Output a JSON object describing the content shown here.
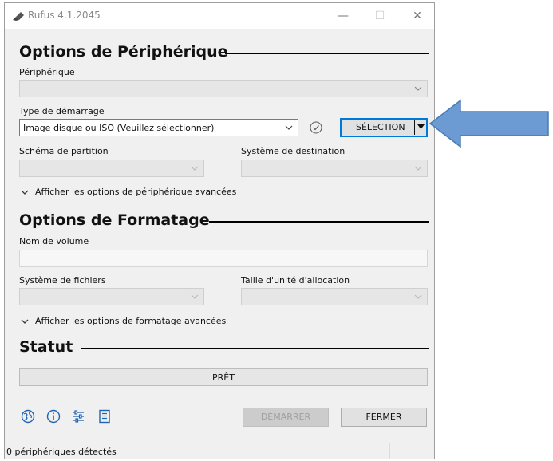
{
  "window": {
    "title": "Rufus 4.1.2045",
    "minimize": "—",
    "maximize": "☐",
    "close": "✕"
  },
  "device_section": {
    "heading": "Options de Périphérique",
    "device_label": "Périphérique",
    "device_value": "",
    "boot_type_label": "Type de démarrage",
    "boot_type_value": "Image disque ou ISO (Veuillez sélectionner)",
    "select_button": "SÉLECTION",
    "partition_label": "Schéma de partition",
    "partition_value": "",
    "target_label": "Système de destination",
    "target_value": "",
    "advanced_toggle": "Afficher les options de périphérique avancées"
  },
  "format_section": {
    "heading": "Options de Formatage",
    "volume_label": "Nom de volume",
    "volume_value": "",
    "filesystem_label": "Système de fichiers",
    "filesystem_value": "",
    "cluster_label": "Taille d'unité d'allocation",
    "cluster_value": "",
    "advanced_toggle": "Afficher les options de formatage avancées"
  },
  "status_section": {
    "heading": "Statut",
    "progress_text": "PRÊT",
    "progress_fraction": 0
  },
  "toolbar": {
    "icons": [
      "globe-icon",
      "info-icon",
      "settings-sliders-icon",
      "log-icon"
    ]
  },
  "buttons": {
    "start": "DÉMARRER",
    "close": "FERMER"
  },
  "statusbar": {
    "text": "0 périphériques détectés"
  },
  "colors": {
    "accent": "#0078d7",
    "arrow": "#6b9bd2",
    "progress": "#06b025"
  }
}
